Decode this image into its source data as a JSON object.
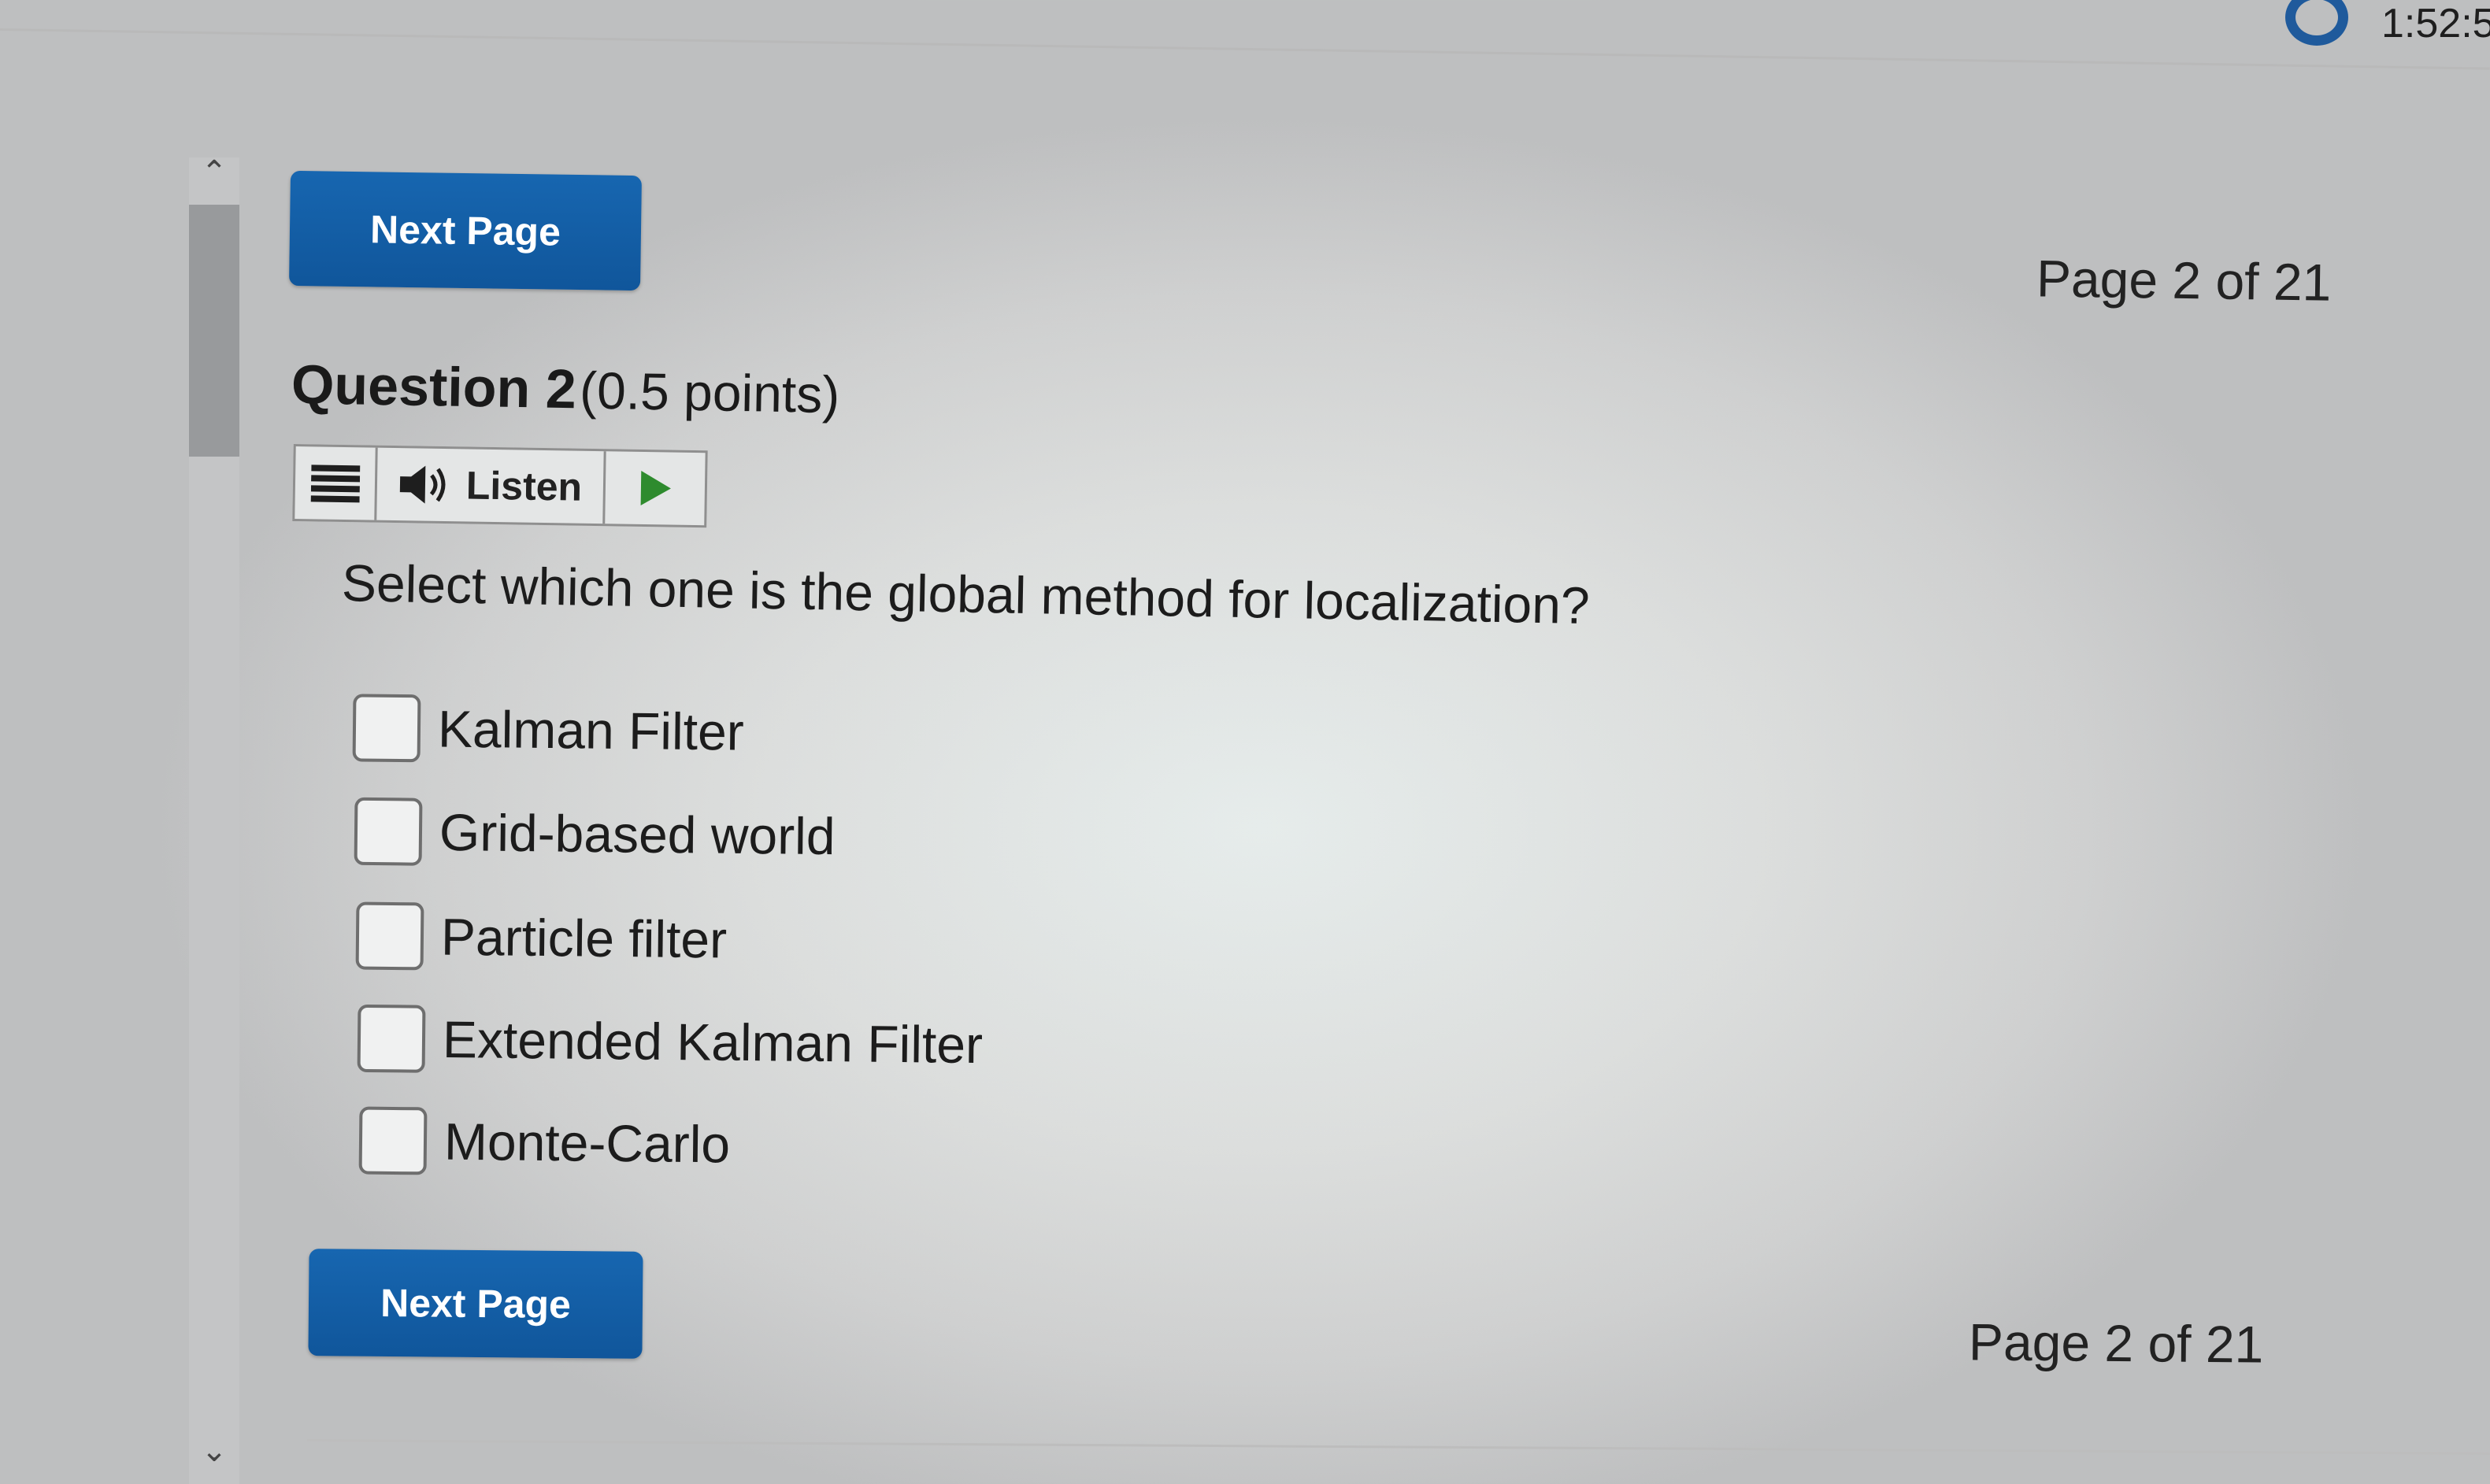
{
  "timer": {
    "text": "1:52:5"
  },
  "nav": {
    "next_label": "Next Page",
    "page_indicator": "Page 2 of 21"
  },
  "question": {
    "title": "Question 2",
    "points": "(0.5 points)",
    "prompt": "Select which one is the global method for localization?",
    "options": [
      {
        "label": "Kalman Filter",
        "checked": false
      },
      {
        "label": "Grid-based world",
        "checked": false
      },
      {
        "label": "Particle filter",
        "checked": false
      },
      {
        "label": "Extended Kalman Filter",
        "checked": false
      },
      {
        "label": "Monte-Carlo",
        "checked": false
      }
    ]
  },
  "listen_toolbar": {
    "listen_label": "Listen",
    "icons": [
      "menu-icon",
      "speaker-icon",
      "play-icon"
    ]
  },
  "colors": {
    "button_blue": "#1766b0",
    "timer_ring": "#1f5a9c",
    "play_green": "#2e8b2e"
  }
}
